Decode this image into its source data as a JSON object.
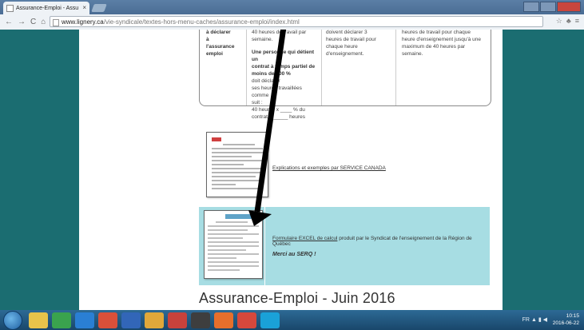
{
  "browser": {
    "tab_title": "Assurance-Emploi - Assu",
    "tab_close": "×",
    "url_host": "www.lignery.ca",
    "url_path": "/vie-syndicale/textes-hors-menu-caches/assurance-emploi/index.html",
    "nav": {
      "back": "←",
      "forward": "→",
      "reload": "C",
      "home": "⌂"
    }
  },
  "table": {
    "col1": [
      "à déclarer",
      "à",
      "l'assurance",
      "emploi"
    ],
    "col2_top": [
      "40 heures de travail par",
      "semaine."
    ],
    "col2_bold": [
      "Une personne qui détient un",
      "contrat à temps partiel de",
      "moins de 100 %"
    ],
    "col2_rest": [
      "doit déclarer",
      "ses heures travaillées comme",
      "suit :",
      "40 heures x ____ % du",
      "contrat = _____ heures"
    ],
    "col3": [
      "doivent déclarer 3",
      "heures de travail pour",
      "chaque heure",
      "d'enseignement."
    ],
    "col4": [
      "heures de travail pour chaque",
      "heure d'enseignement jusqu'à une",
      "maximum de 40 heures par",
      "semaine."
    ]
  },
  "service_canada_link": "Explications et exemples par SERVICE CANADA",
  "excel": {
    "link": "Formulaire EXCEL de calcul",
    "rest": " produit par le Syndicat de l'enseignement de la Région de Québec",
    "thanks": "Merci au SERQ !"
  },
  "page_title": "Assurance-Emploi - Juin 2016",
  "taskbar": {
    "lang": "FR",
    "time": "10:15",
    "date": "2016-06-22"
  },
  "colors": {
    "page_bg": "#1b6d71",
    "excel_block": "#a7dde3",
    "arrow": "#000000"
  }
}
